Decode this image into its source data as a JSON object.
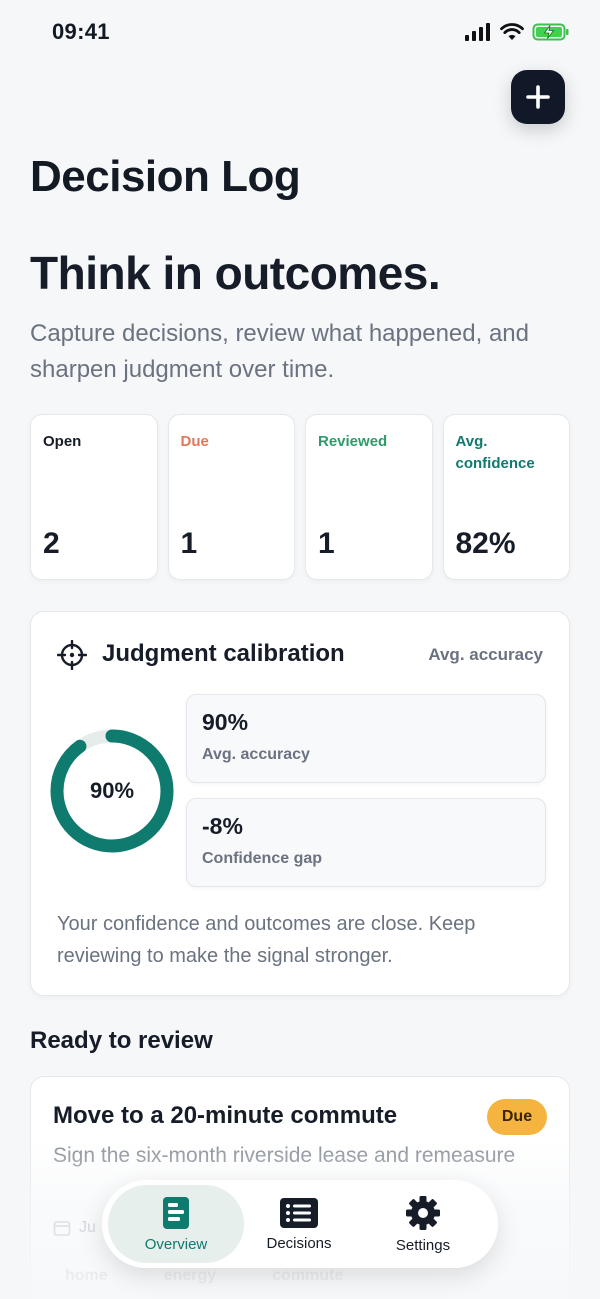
{
  "status_bar": {
    "time": "09:41"
  },
  "header": {
    "title": "Decision Log",
    "add_icon": "plus-icon"
  },
  "hero": {
    "title": "Think in outcomes.",
    "subtitle": "Capture decisions, review what happened, and sharpen judgment over time."
  },
  "stats": [
    {
      "label": "Open",
      "value": "2",
      "color": "#161c28"
    },
    {
      "label": "Due",
      "value": "1",
      "color": "#e0795a"
    },
    {
      "label": "Reviewed",
      "value": "1",
      "color": "#2f9a6a"
    },
    {
      "label": "Avg. confidence",
      "value": "82%",
      "color": "#0f7a6e"
    }
  ],
  "calibration": {
    "title": "Judgment calibration",
    "side_label": "Avg. accuracy",
    "ring_value": "90%",
    "ring_fraction": 0.9,
    "ring_color": "#0f7a6e",
    "metrics": [
      {
        "value": "90%",
        "label": "Avg. accuracy"
      },
      {
        "value": "-8%",
        "label": "Confidence gap"
      }
    ],
    "note": "Your confidence and outcomes are close. Keep reviewing to make the signal stronger."
  },
  "review_section": {
    "title": "Ready to review",
    "item": {
      "title": "Move to a 20-minute commute",
      "badge": "Due",
      "description": "Sign the six-month riverside lease and remeasure",
      "meta": "Ju",
      "tags": [
        "home",
        "energy",
        "commute"
      ]
    }
  },
  "tab_bar": {
    "tabs": [
      {
        "label": "Overview",
        "icon": "overview-icon",
        "active": true
      },
      {
        "label": "Decisions",
        "icon": "list-icon",
        "active": false
      },
      {
        "label": "Settings",
        "icon": "gear-icon",
        "active": false
      }
    ]
  },
  "colors": {
    "accent": "#0f7a6e",
    "due_badge": "#f5b43f"
  }
}
